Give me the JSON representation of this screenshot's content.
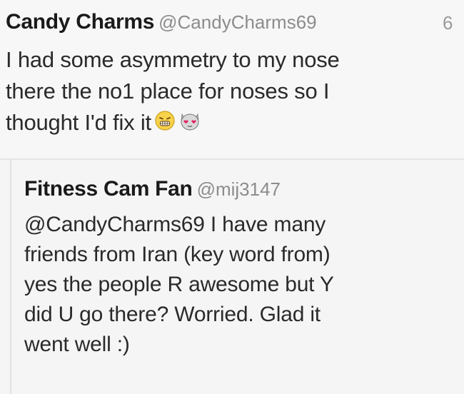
{
  "tweet": {
    "display_name": "Candy Charms",
    "handle": "@CandyCharms69",
    "timestamp": "6",
    "lines": [
      "I had some asymmetry to my nose",
      "there the no1 place for noses so I",
      "thought I'd fix it"
    ],
    "emojis": [
      "grimacing-face-emoji",
      "heart-eyes-cat-emoji"
    ]
  },
  "reply": {
    "display_name": "Fitness Cam Fan",
    "handle": "@mij3147",
    "lines": [
      "@CandyCharms69  I have many",
      "friends from Iran (key word from)",
      "yes the people R awesome but Y",
      "did U go there? Worried.  Glad it",
      "went well :)"
    ]
  },
  "colors": {
    "name": "#1a1a1a",
    "handle": "#8c8c8c",
    "body": "#2a2a2a",
    "background": "#f7f7f7"
  }
}
